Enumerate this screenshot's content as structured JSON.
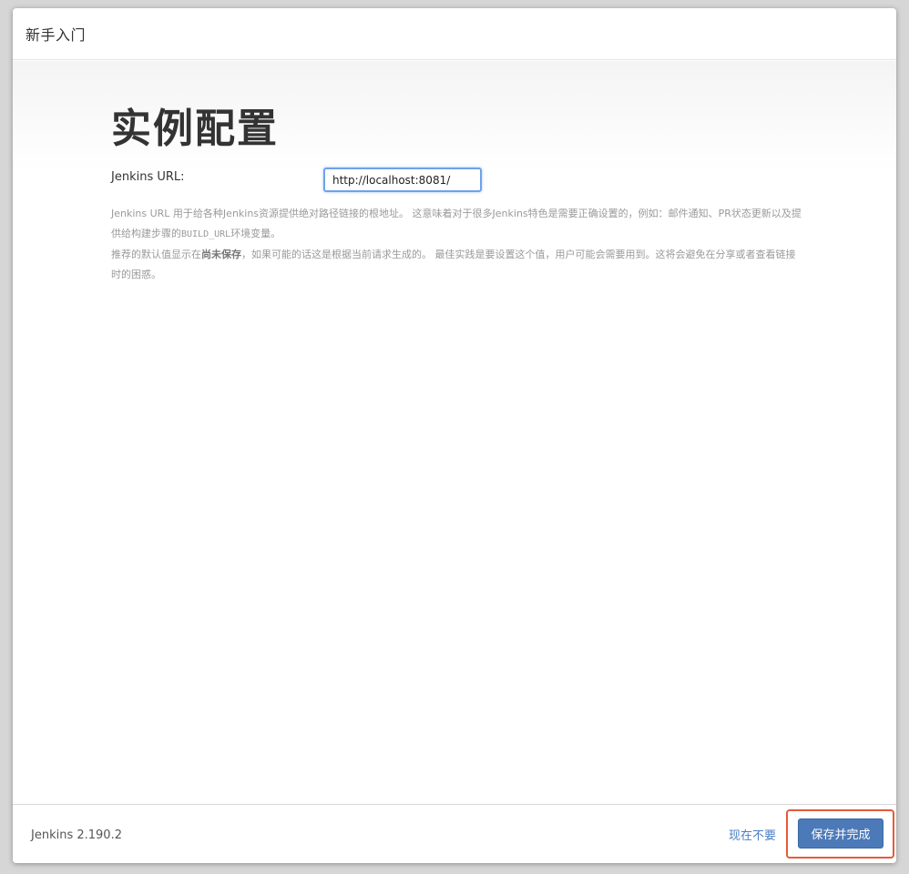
{
  "header": {
    "title": "新手入门"
  },
  "main": {
    "title": "实例配置",
    "url_label": "Jenkins URL:",
    "url_value": "http://localhost:8081/",
    "help": {
      "p1_text": "Jenkins URL 用于给各种Jenkins资源提供绝对路径链接的根地址。 这意味着对于很多Jenkins特色是需要正确设置的，例如：邮件通知、PR状态更新以及提供给构建步骤的",
      "p1_code": "BUILD_URL",
      "p1_end": "环境变量。",
      "p2_start": "推荐的默认值显示在",
      "p2_bold": "尚未保存",
      "p2_end": "，如果可能的话这是根据当前请求生成的。 最佳实践是要设置这个值，用户可能会需要用到。这将会避免在分享或者查看链接时的困惑。"
    }
  },
  "footer": {
    "version": "Jenkins 2.190.2",
    "skip_label": "现在不要",
    "save_label": "保存并完成"
  },
  "colors": {
    "primary": "#4c79b8",
    "link": "#4a7fc1",
    "highlight": "#e55a3a"
  }
}
